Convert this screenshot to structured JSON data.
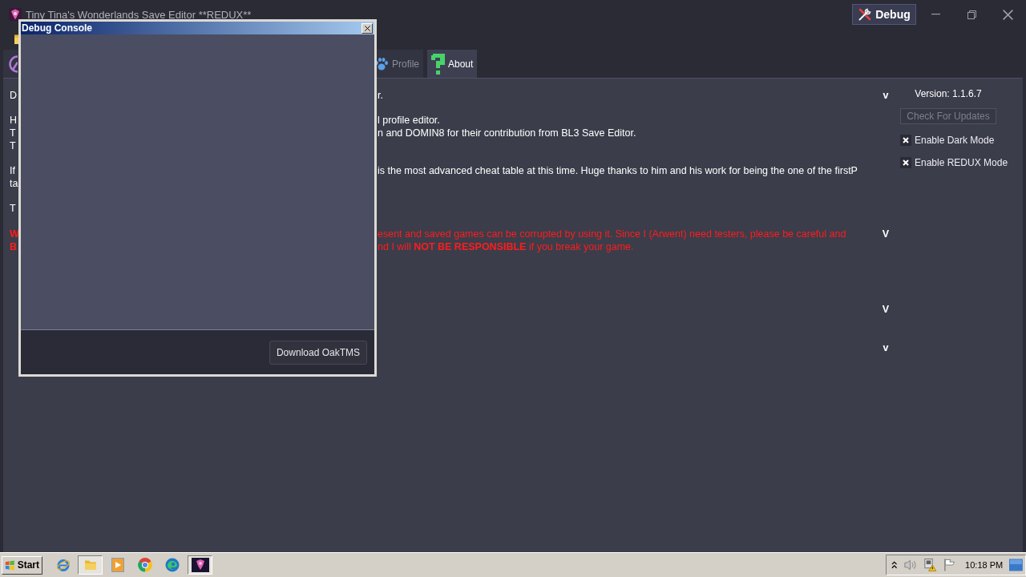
{
  "window": {
    "title": "Tiny Tina's Wonderlands Save Editor **REDUX**",
    "debug_button": "Debug"
  },
  "tabs": [
    {
      "selected": false
    },
    {
      "label": "Profile",
      "selected": false
    },
    {
      "label": "About",
      "selected": true
    }
  ],
  "about": {
    "sections": [
      {
        "kind": "info",
        "toggle": "v",
        "paragraphs": [
          [
            {
              "left": "D",
              "right": "r."
            }
          ],
          [
            {
              "left": "H",
              "right": "l profile editor."
            },
            {
              "left": "T",
              "right": "n and DOMIN8 for their contribution from BL3 Save Editor."
            },
            {
              "left": "T"
            }
          ],
          [
            {
              "left": "If",
              "right": "is the most advanced cheat table at this time. Huge thanks to him and his work for being the one of the firstP"
            },
            {
              "left": "ta"
            }
          ],
          [
            {
              "left": "T"
            }
          ]
        ]
      },
      {
        "kind": "warning",
        "toggle": "V",
        "paragraphs": [
          [
            {
              "left": "W",
              "right": "esent and saved games can be corrupted by using it. Since I (Arwent) need testers, please be careful and"
            },
            {
              "left": "B",
              "right": "nd I will **NOT BE RESPONSIBLE** if you break your game."
            }
          ]
        ]
      },
      {
        "kind": "info",
        "toggle": "V"
      },
      {
        "kind": "info",
        "toggle": "v"
      }
    ]
  },
  "sidebar": {
    "version": "Version: 1.1.6.7",
    "update_button": {
      "label": "Check For Updates",
      "disabled": true
    },
    "options": [
      {
        "label": "Enable Dark Mode",
        "checked": true
      },
      {
        "label": "Enable REDUX Mode",
        "checked": true
      }
    ]
  },
  "debug_console": {
    "title": "Debug Console",
    "download_button": "Download OakTMS"
  },
  "taskbar": {
    "start": "Start",
    "clock": "10:18 PM"
  }
}
